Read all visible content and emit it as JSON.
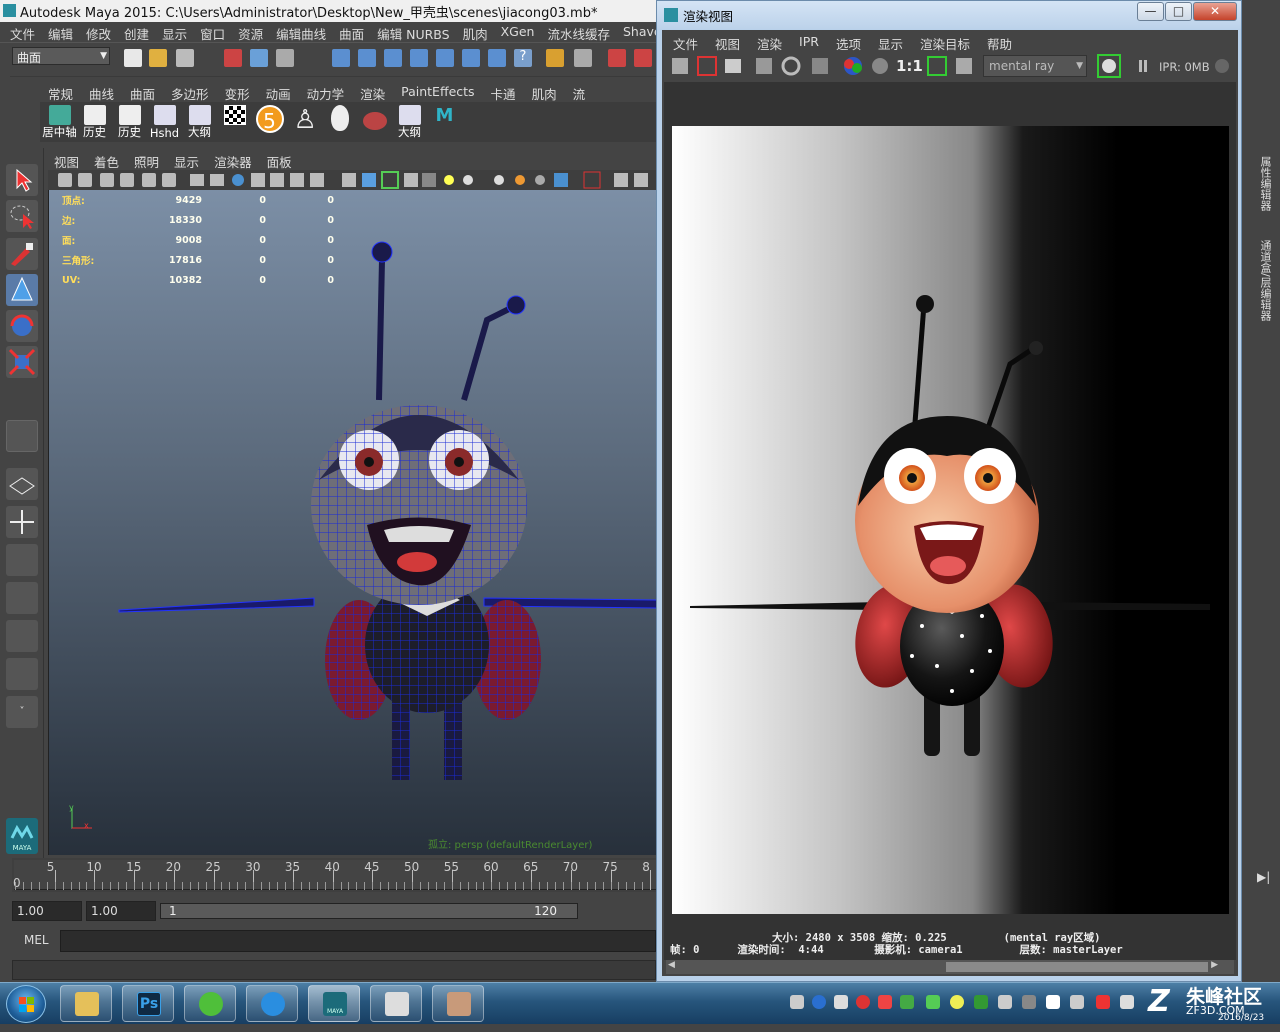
{
  "maya": {
    "title": "Autodesk Maya 2015: C:\\Users\\Administrator\\Desktop\\New_甲壳虫\\scenes\\jiacong03.mb*",
    "menu": [
      "文件",
      "编辑",
      "修改",
      "创建",
      "显示",
      "窗口",
      "资源",
      "编辑曲线",
      "曲面",
      "编辑 NURBS",
      "肌肉",
      "XGen",
      "流水线缓存",
      "Shave"
    ],
    "mode": "曲面",
    "shelf_tabs": [
      "常规",
      "曲线",
      "曲面",
      "多边形",
      "变形",
      "动画",
      "动力学",
      "渲染",
      "PaintEffects",
      "卡通",
      "肌肉",
      "流"
    ],
    "shelf_buttons": [
      "居中轴",
      "历史",
      "历史",
      "Hshd",
      "大纲",
      "",
      "5",
      "",
      "",
      "",
      "大纲",
      ""
    ],
    "viewport_menu": [
      "视图",
      "着色",
      "照明",
      "显示",
      "渲染器",
      "面板"
    ],
    "hud": [
      {
        "label": "顶点:",
        "v1": "9429",
        "v2": "0",
        "v3": "0"
      },
      {
        "label": "边:",
        "v1": "18330",
        "v2": "0",
        "v3": "0"
      },
      {
        "label": "面:",
        "v1": "9008",
        "v2": "0",
        "v3": "0"
      },
      {
        "label": "三角形:",
        "v1": "17816",
        "v2": "0",
        "v3": "0"
      },
      {
        "label": "UV:",
        "v1": "10382",
        "v2": "0",
        "v3": "0"
      }
    ],
    "camera_label": "孤立: persp (defaultRenderLayer)",
    "axis": {
      "x": "x",
      "y": "y"
    },
    "timeline_ticks": [
      "5",
      "10",
      "15",
      "20",
      "25",
      "30",
      "35",
      "40",
      "45",
      "50",
      "55",
      "60",
      "65",
      "70",
      "75",
      "8"
    ],
    "timeline_start": "0",
    "range": {
      "start": "1.00",
      "start2": "1.00",
      "slider_start": "1",
      "slider_end": "120"
    },
    "cmd_label": "MEL",
    "maya_logo": "MAYA"
  },
  "render_view": {
    "title": "渲染视图",
    "window_buttons": {
      "minimize": "—",
      "maximize": "□",
      "close": "✕"
    },
    "menu": [
      "文件",
      "视图",
      "渲染",
      "IPR",
      "选项",
      "显示",
      "渲染目标",
      "帮助"
    ],
    "ratio": "1:1",
    "renderer": "mental ray",
    "ipr_memory": "IPR: 0MB",
    "info_line1": "大小: 2480 x 3508 缩放: 0.225         (mental ray区域)",
    "info_line2": "帧: 0      渲染时间:  4:44        摄影机: camera1         层数: masterLayer"
  },
  "right_panel": {
    "tab1": "属性编辑器",
    "tab2": "通道盒/层编辑器"
  },
  "taskbar": {
    "apps": [
      "explorer",
      "photoshop",
      "refresh",
      "internet-explorer",
      "maya",
      "calculator",
      "photo"
    ],
    "ps_label": "Ps",
    "maya_label": "MAYA"
  },
  "watermark": {
    "brand": "朱峰社区",
    "site": "ZF3D.COM",
    "date": "2016/8/23"
  },
  "colors": {
    "accent": "#2a8fa0",
    "hud": "#ffde5a"
  }
}
